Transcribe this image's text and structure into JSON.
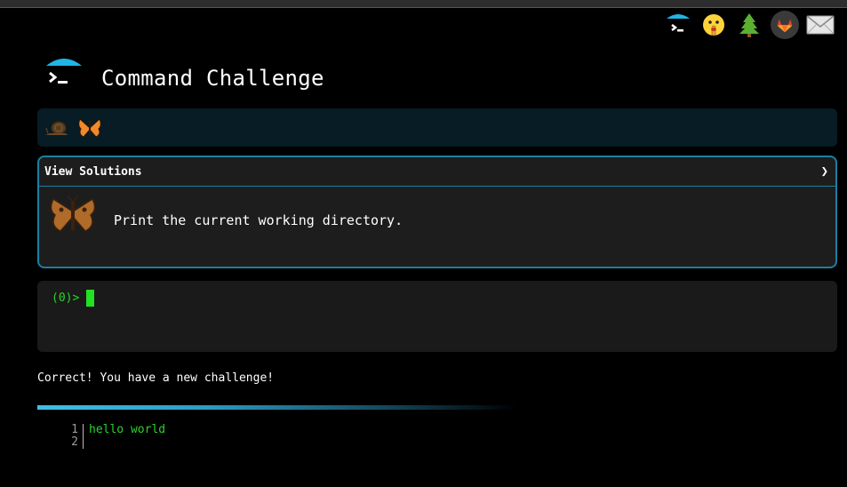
{
  "header": {
    "title": "Command Challenge",
    "logo_icon": "terminal-umbrella-icon"
  },
  "top_icons": [
    {
      "name": "terminal-umbrella-icon"
    },
    {
      "name": "shushing-face-icon"
    },
    {
      "name": "evergreen-tree-icon"
    },
    {
      "name": "gitlab-icon"
    },
    {
      "name": "envelope-icon"
    }
  ],
  "progress": {
    "badges": [
      "snail-icon",
      "butterfly-icon"
    ]
  },
  "challenge": {
    "solutions_label": "View Solutions",
    "chevron": "❯",
    "icon": "moth-icon",
    "text": "Print the current working directory."
  },
  "terminal": {
    "prompt": "(0)>"
  },
  "message": "Correct! You have a new challenge!",
  "code": {
    "line_numbers": [
      "1",
      "2"
    ],
    "lines": [
      "hello world",
      ""
    ]
  },
  "colors": {
    "accent": "#1d7fa0",
    "prompt_green": "#2bd42b",
    "cursor_green": "#23e123",
    "progress_bg": "#071c24",
    "card_bg": "#1d1d1d"
  }
}
